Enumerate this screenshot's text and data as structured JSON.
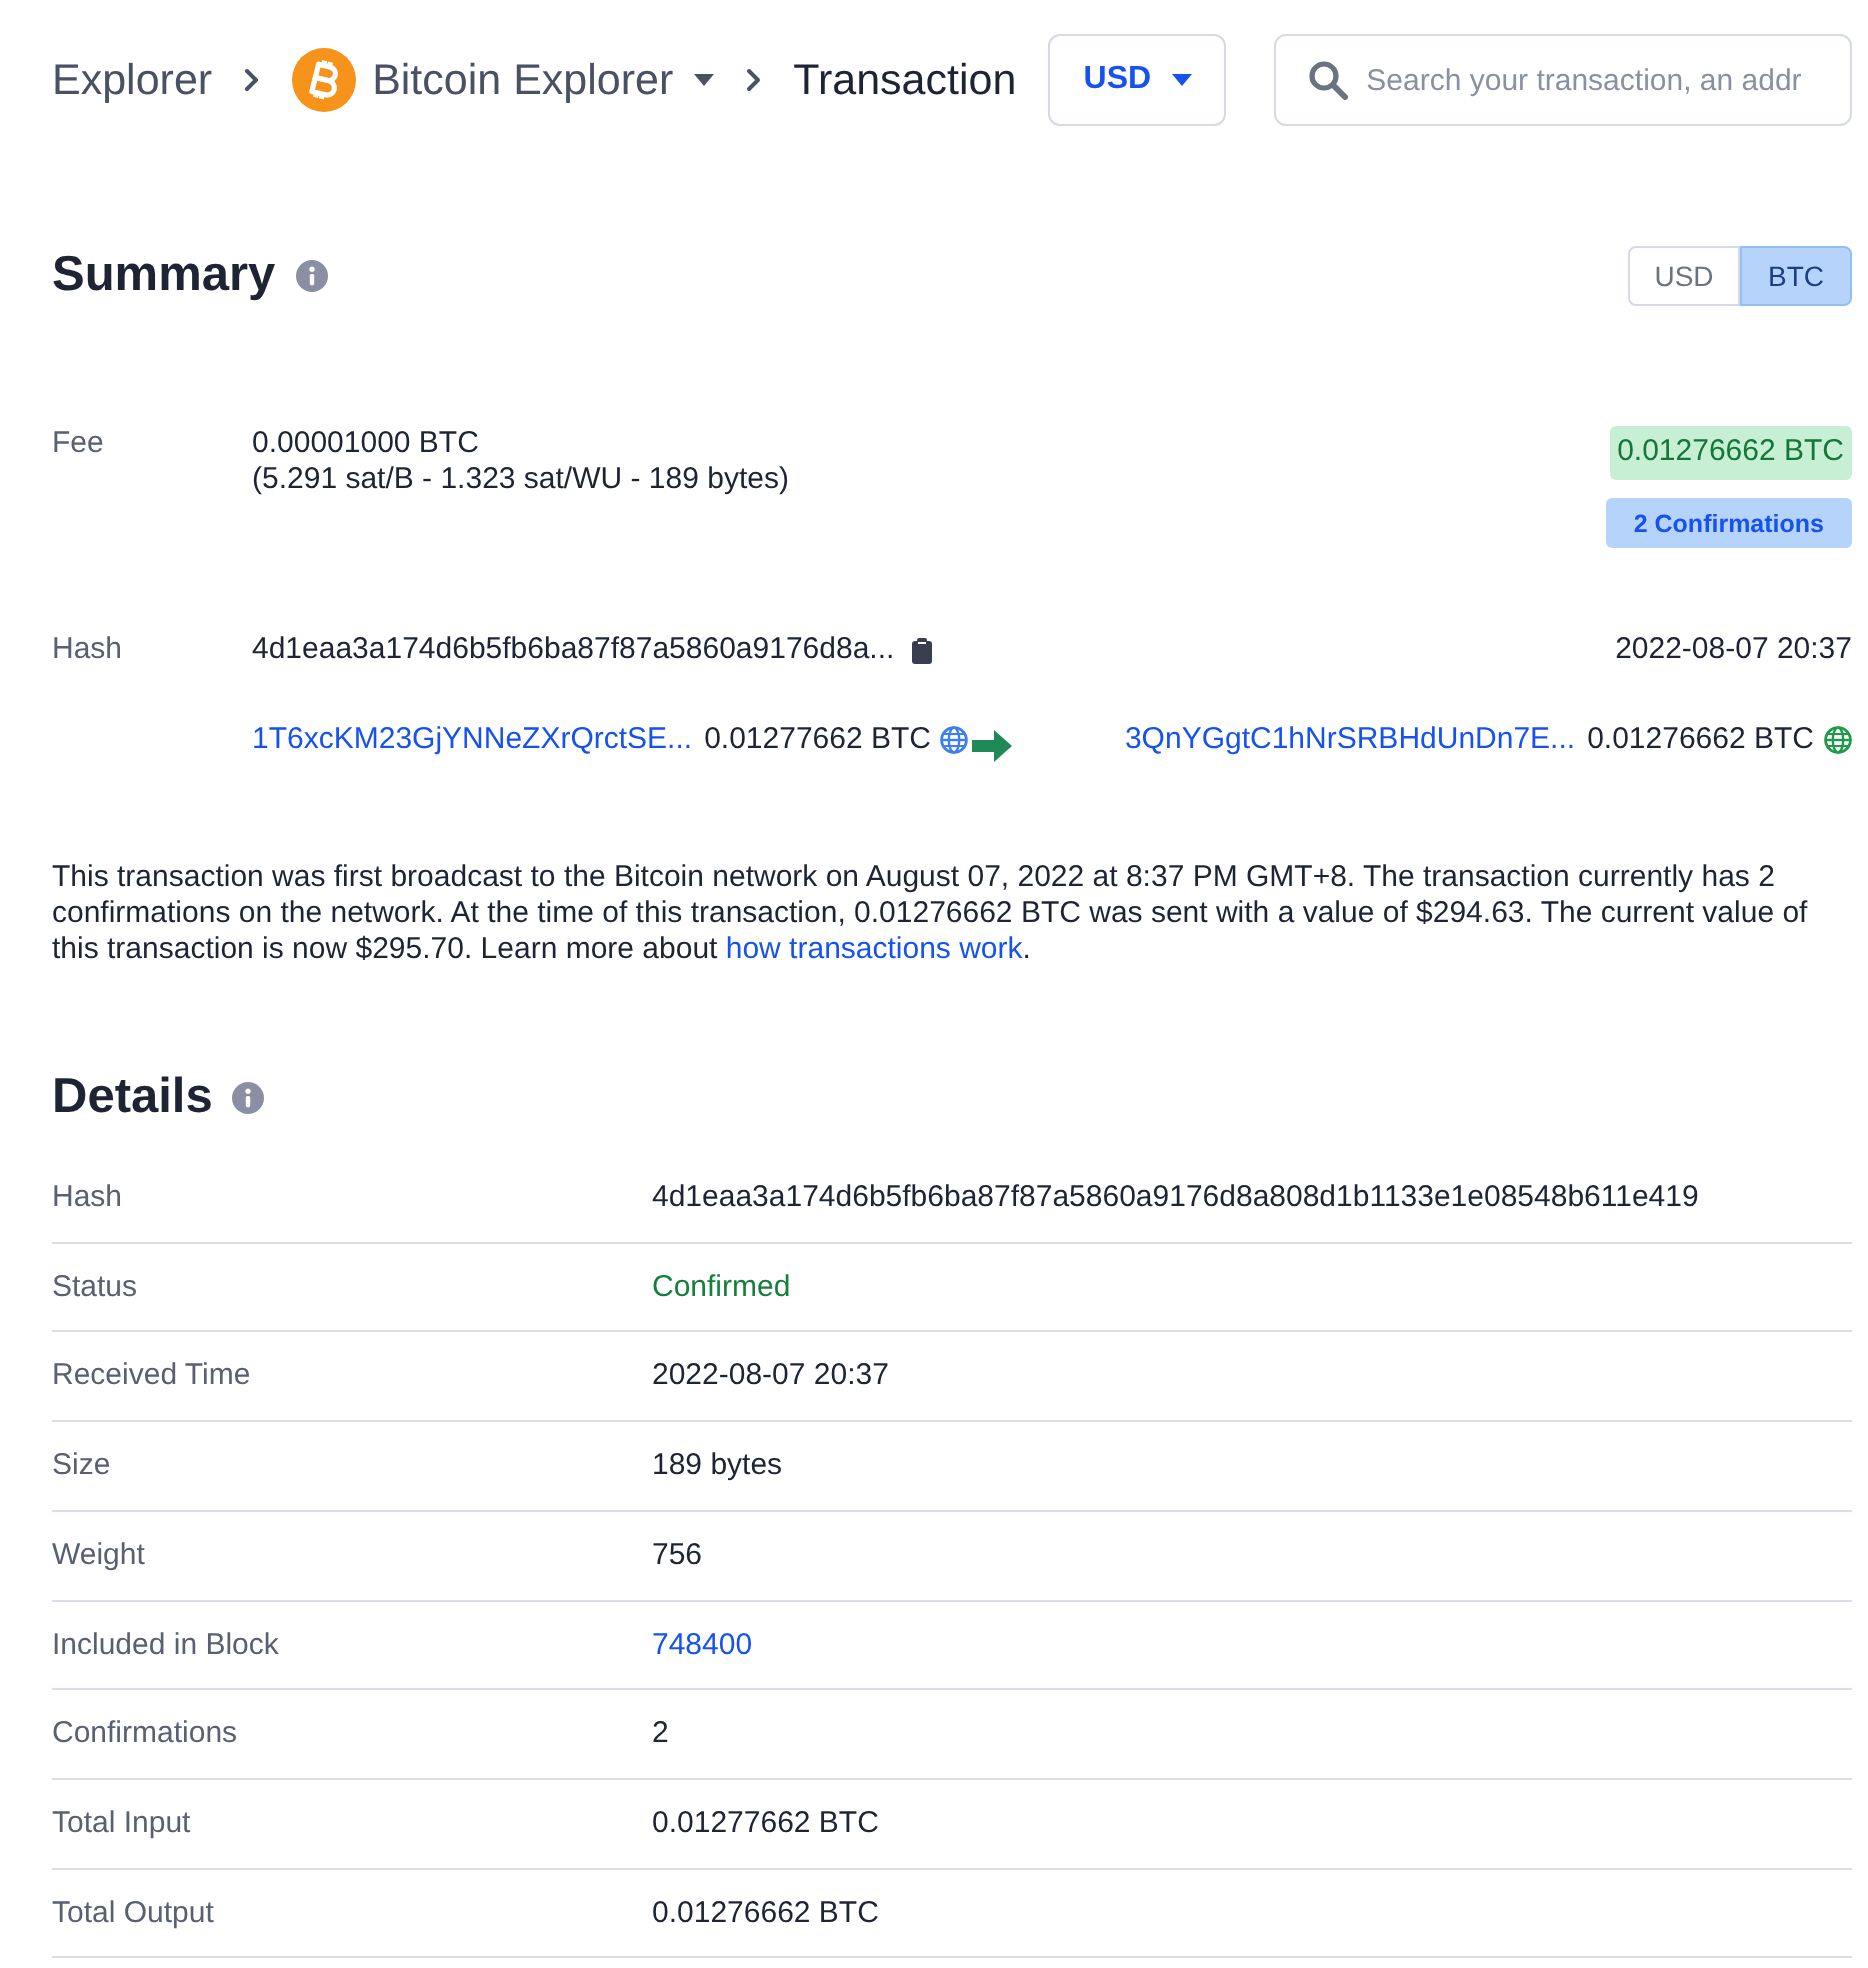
{
  "breadcrumb": {
    "items": [
      {
        "label": "Explorer",
        "kind": "link"
      },
      {
        "label": "Bitcoin Explorer",
        "kind": "network"
      },
      {
        "label": "Transaction",
        "kind": "current"
      }
    ]
  },
  "currency_select": {
    "value": "USD"
  },
  "search": {
    "placeholder": "Search your transaction, an addr"
  },
  "summary": {
    "title": "Summary",
    "unit_toggle": [
      {
        "label": "USD",
        "selected": false
      },
      {
        "label": "BTC",
        "selected": true
      }
    ],
    "fee": {
      "label": "Fee",
      "value": "0.00001000 BTC",
      "detail": "(5.291 sat/B - 1.323 sat/WU - 189 bytes)"
    },
    "amount_badge": "0.01276662 BTC",
    "confirmations_badge": "2 Confirmations",
    "hash": {
      "label": "Hash",
      "value": "4d1eaa3a174d6b5fb6ba87f87a5860a9176d8a...",
      "time": "2022-08-07 20:37"
    },
    "input": {
      "address": "1T6xcKM23GjYNNeZXrQrctSE...",
      "amount": "0.01277662 BTC"
    },
    "output": {
      "address": "3QnYGgtC1hNrSRBHdUnDn7E...",
      "amount": "0.01276662 BTC"
    },
    "description": {
      "text": "This transaction was first broadcast to the Bitcoin network on August 07, 2022 at 8:37 PM GMT+8. The transaction currently has 2 confirmations on the network. At the time of this transaction, 0.01276662 BTC was sent with a value of $294.63. The current value of this transaction is now $295.70. Learn more about ",
      "link": "how transactions work",
      "end": "."
    }
  },
  "details": {
    "title": "Details",
    "rows": [
      {
        "label": "Hash",
        "value": "4d1eaa3a174d6b5fb6ba87f87a5860a9176d8a808d1b1133e1e08548b611e419",
        "kind": "text"
      },
      {
        "label": "Status",
        "value": "Confirmed",
        "kind": "status"
      },
      {
        "label": "Received Time",
        "value": "2022-08-07 20:37",
        "kind": "text"
      },
      {
        "label": "Size",
        "value": "189 bytes",
        "kind": "text"
      },
      {
        "label": "Weight",
        "value": "756",
        "kind": "text"
      },
      {
        "label": "Included in Block",
        "value": "748400",
        "kind": "link"
      },
      {
        "label": "Confirmations",
        "value": "2",
        "kind": "text"
      },
      {
        "label": "Total Input",
        "value": "0.01277662 BTC",
        "kind": "text"
      },
      {
        "label": "Total Output",
        "value": "0.01276662 BTC",
        "kind": "text"
      }
    ]
  }
}
